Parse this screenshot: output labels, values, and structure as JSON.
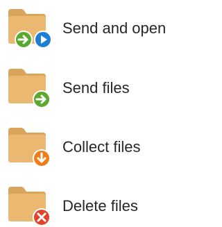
{
  "items": [
    {
      "label": "Send and open",
      "badges": [
        "arrow-right-green-icon",
        "play-blue-icon"
      ]
    },
    {
      "label": "Send files",
      "badges": [
        "arrow-right-green-icon"
      ]
    },
    {
      "label": "Collect files",
      "badges": [
        "arrow-down-orange-icon"
      ]
    },
    {
      "label": "Delete files",
      "badges": [
        "close-red-icon"
      ]
    }
  ],
  "colors": {
    "folder_body": "#eab870",
    "folder_tab": "#d9a55c",
    "green": "#5aa82f",
    "blue": "#1c7fd6",
    "orange": "#ef7d1a",
    "red": "#e0442b",
    "text": "#262626"
  }
}
